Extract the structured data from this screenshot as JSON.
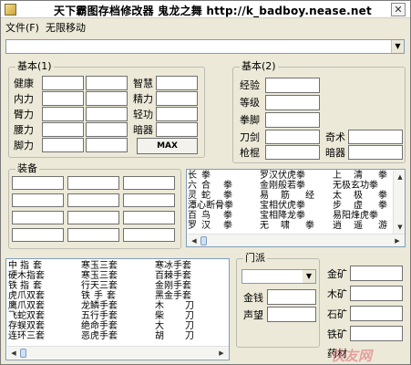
{
  "window": {
    "title": "天下霸图存档修改器 鬼龙之舞 http://k_badboy.nease.net",
    "close_glyph": "✕"
  },
  "menu": {
    "items": [
      "文件(F)",
      "无限移动"
    ]
  },
  "top_combo": {
    "value": "",
    "arrow": "▼"
  },
  "basic1": {
    "title": "基本(1)",
    "labels_left": [
      "健康",
      "内力",
      "臂力",
      "腰力",
      "脚力"
    ],
    "labels_right": [
      "智慧",
      "精力",
      "轻功",
      "暗器"
    ],
    "max_button": "MAX"
  },
  "basic2": {
    "title": "基本(2)",
    "labels_left": [
      "经验",
      "等级",
      "拳脚",
      "刀剑",
      "枪棍"
    ],
    "labels_right": [
      "奇术",
      "暗器"
    ]
  },
  "equip": {
    "title": "装备"
  },
  "skills_list": {
    "rows": [
      [
        "长",
        "拳",
        "罗汉伏虎拳",
        "上",
        "清",
        "拳"
      ],
      [
        "六",
        "合",
        "拳",
        "金刚般若拳",
        "无极玄功拳"
      ],
      [
        "灵",
        "蛇",
        "拳",
        "易",
        "筋",
        "经",
        "太",
        "极",
        "拳"
      ],
      [
        "潭心断骨拳",
        "宝相伏虎拳",
        "步",
        "虚",
        "拳"
      ],
      [
        "百",
        "鸟",
        "拳",
        "宝相降龙拳",
        "易阳烽虎拳"
      ],
      [
        "罗",
        "汉",
        "拳",
        "无",
        "啸",
        "拳",
        "逍",
        "遥",
        "游"
      ]
    ]
  },
  "weapons_list": {
    "rows": [
      [
        "中",
        "指",
        "套",
        "寒玉三套",
        "寒冰手套"
      ],
      [
        "硬木指套",
        "寒玉三套",
        "百棘手套"
      ],
      [
        "铁",
        "指",
        "套",
        "行天三套",
        "金刚手套"
      ],
      [
        "虎爪双套",
        "铁",
        "手",
        "套",
        "黑金手套"
      ],
      [
        "鹰爪双套",
        "龙鳞手套",
        "木",
        "",
        "刀"
      ],
      [
        "飞蛇双套",
        "五行手套",
        "柴",
        "",
        "刀"
      ],
      [
        "存蜈双套",
        "绝命手套",
        "大",
        "",
        "刀"
      ],
      [
        "连环三套",
        "恶虎手套",
        "胡",
        "",
        "刀"
      ]
    ]
  },
  "menpai": {
    "title": "门派",
    "select_value": "",
    "arrow": "▼",
    "money_label": "金钱",
    "fame_label": "声望",
    "ore_labels": [
      "金矿",
      "木矿",
      "石矿",
      "铁矿",
      "药材"
    ]
  },
  "scroll": {
    "left": "◀",
    "right": "▶",
    "up": "▲",
    "down": "▼"
  },
  "watermark": "快友网"
}
